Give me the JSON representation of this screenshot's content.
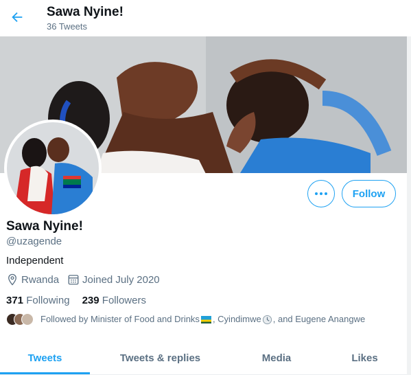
{
  "header": {
    "title": "Sawa Nyine!",
    "tweet_count": "36 Tweets",
    "back_icon": "arrow-left-icon"
  },
  "colors": {
    "accent": "#1da1f2",
    "text_primary": "#0f1419",
    "text_secondary": "#5b7083"
  },
  "profile": {
    "name": "Sawa Nyine!",
    "handle": "@uzagende",
    "bio": "Independent",
    "location": "Rwanda",
    "joined": "Joined July 2020",
    "following_count": "371",
    "following_label": "Following",
    "followers_count": "239",
    "followers_label": "Followers"
  },
  "actions": {
    "more_icon": "more-dots-icon",
    "follow_label": "Follow"
  },
  "followed_by": {
    "prefix": "Followed by Minister of Food and Drinks",
    "middle": ", Cyindimwe",
    "suffix": ", and Eugene Anangwe"
  },
  "tabs": [
    {
      "label": "Tweets",
      "active": true
    },
    {
      "label": "Tweets & replies",
      "active": false
    },
    {
      "label": "Media",
      "active": false
    },
    {
      "label": "Likes",
      "active": false
    }
  ]
}
